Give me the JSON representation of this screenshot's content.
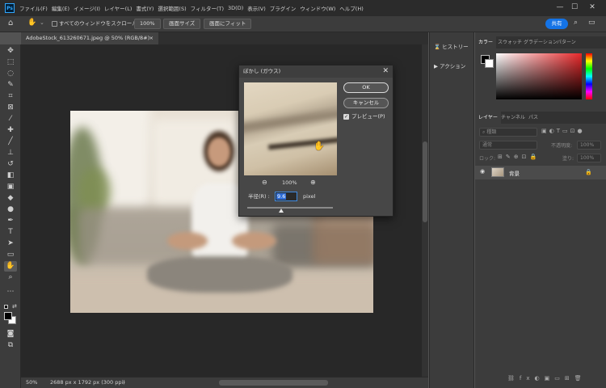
{
  "app": {
    "logo": "Ps"
  },
  "menu": [
    "ファイル(F)",
    "編集(E)",
    "イメージ(I)",
    "レイヤー(L)",
    "書式(Y)",
    "選択範囲(S)",
    "フィルター(T)",
    "3D(D)",
    "表示(V)",
    "プラグイン",
    "ウィンドウ(W)",
    "ヘルプ(H)"
  ],
  "window_controls": {
    "minimize": "—",
    "maximize": "☐",
    "close": "✕"
  },
  "options": {
    "scroll_all_label": "すべてのウィンドウをスクロール",
    "zoom_100": "100%",
    "fit_screen": "画面サイズ",
    "fill_screen": "画面にフィット",
    "share": "共有"
  },
  "document": {
    "tab_title": "AdobeStock_613260671.jpeg @ 50% (RGB/8#)",
    "close": "×"
  },
  "status": {
    "zoom": "50%",
    "dimensions": "2688 px x 1792 px (300 ppi)",
    "arrow": "›"
  },
  "collapsed_panels": [
    {
      "icon": "history-icon",
      "label": "ヒストリー"
    },
    {
      "icon": "actions-icon",
      "label": "アクション"
    }
  ],
  "color_panel": {
    "tabs": [
      "カラー",
      "スウォッチ",
      "グラデーション",
      "パターン"
    ]
  },
  "layers_panel": {
    "tabs": [
      "レイヤー",
      "チャンネル",
      "パス"
    ],
    "search_placeholder": "種類",
    "blend_mode": "通常",
    "opacity_label": "不透明度:",
    "opacity_value": "100%",
    "lock_label": "ロック:",
    "fill_label": "塗り:",
    "fill_value": "100%",
    "layers": [
      {
        "name": "背景",
        "visible": true,
        "locked": true
      }
    ]
  },
  "dialog": {
    "title": "ぼかし (ガウス)",
    "close": "✕",
    "ok": "OK",
    "cancel": "キャンセル",
    "preview_label": "プレビュー(P)",
    "preview_checked": true,
    "zoom_out": "⊖",
    "zoom": "100%",
    "zoom_in": "⊕",
    "radius_label": "半径(R) :",
    "radius_value": "9.6",
    "radius_unit": "pixel",
    "slider_fraction": 0.4
  },
  "tools": [
    "move-icon",
    "marquee-icon",
    "lasso-icon",
    "quick-select-icon",
    "crop-icon",
    "frame-icon",
    "eyedropper-icon",
    "healing-icon",
    "brush-icon",
    "stamp-icon",
    "history-brush-icon",
    "eraser-icon",
    "gradient-icon",
    "blur-icon",
    "dodge-icon",
    "pen-icon",
    "type-icon",
    "path-select-icon",
    "shape-icon",
    "hand-icon",
    "zoom-icon",
    "more-icon"
  ],
  "colors": {
    "accent": "#1473e6",
    "foreground": "#000000",
    "background": "#ffffff"
  }
}
